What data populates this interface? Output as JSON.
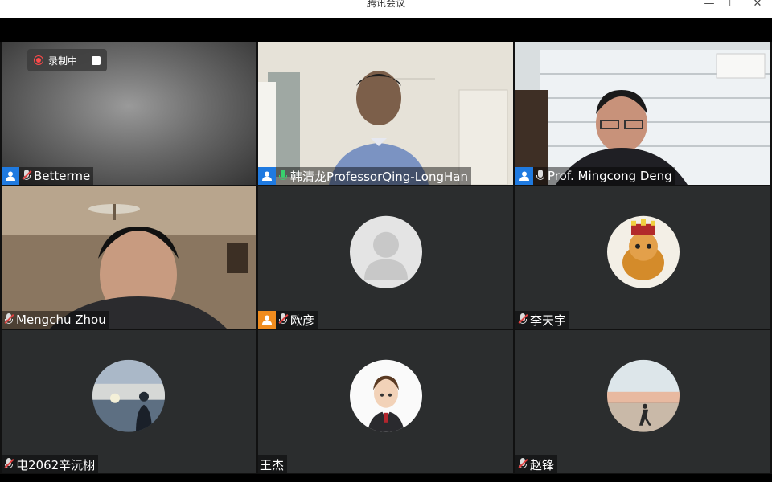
{
  "window": {
    "title": "腾讯会议",
    "minimize": "—",
    "maximize": "☐",
    "close": "✕"
  },
  "recording": {
    "label": "录制中"
  },
  "participants": [
    {
      "name": "Betterme",
      "icon": "user-icon",
      "mic": "muted"
    },
    {
      "name": "韩清龙ProfessorQing-LongHan",
      "icon": "user-icon",
      "mic": "speaking",
      "active": true
    },
    {
      "name": "Prof. Mingcong Deng",
      "icon": "user-icon",
      "mic": "muted"
    },
    {
      "name": "Mengchu Zhou",
      "mic": "muted"
    },
    {
      "name": "欧彦",
      "icon": "user-icon",
      "mic": "muted"
    },
    {
      "name": "李天宇",
      "mic": "muted"
    },
    {
      "name": "电2062辛沅栩",
      "mic": "muted"
    },
    {
      "name": "王杰"
    },
    {
      "name": "赵锋",
      "mic": "muted"
    }
  ],
  "colors": {
    "accent_green": "#31c26b",
    "host_blue": "#1f7ae0",
    "guest_orange": "#f08c1e"
  }
}
